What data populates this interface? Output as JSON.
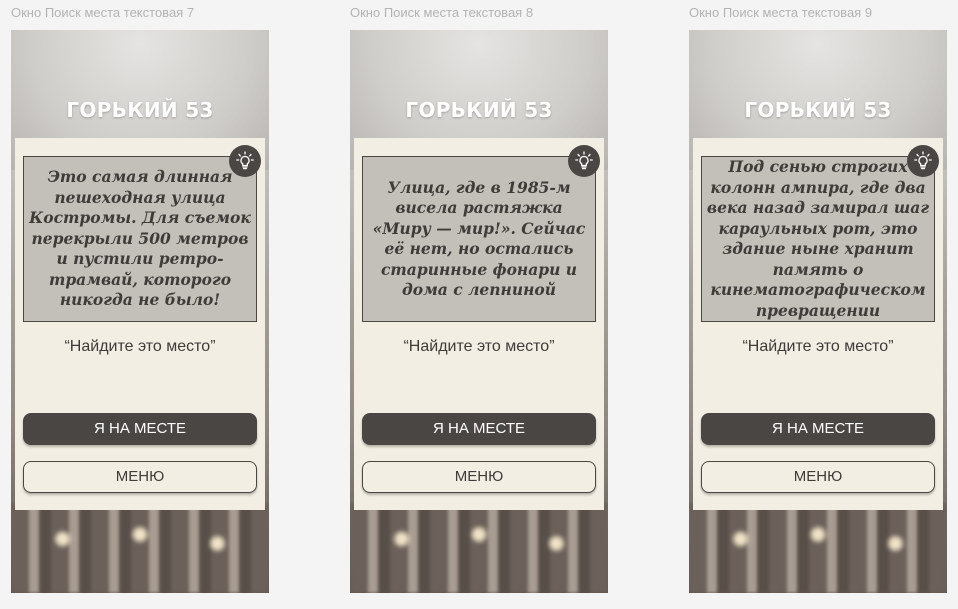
{
  "frames": [
    {
      "label": "Окно Поиск места текстовая 7",
      "title": "ГОРЬКИЙ 53",
      "quote": "Это самая длинная пешеходная улица Костромы. Для съемок перекрыли 500 метров и пустили ретро-трамвай, которого никогда не было!",
      "prompt": "“Найдите это место”",
      "primary_button": "Я НА МЕСТЕ",
      "secondary_button": "МЕНЮ"
    },
    {
      "label": "Окно Поиск места текстовая 8",
      "title": "ГОРЬКИЙ 53",
      "quote": "Улица, где в 1985-м висела растяжка «Миру — мир!». Сейчас её нет, но остались старинные фонари и дома с лепниной",
      "prompt": "“Найдите это место”",
      "primary_button": "Я НА МЕСТЕ",
      "secondary_button": "МЕНЮ"
    },
    {
      "label": "Окно Поиск места текстовая 9",
      "title": "ГОРЬКИЙ 53",
      "quote": "Под сенью строгих колонн ампира, где два века назад замирал шаг караульных рот, это здание ныне хранит память о кинематографическом превращении",
      "prompt": "“Найдите это место”",
      "primary_button": "Я НА МЕСТЕ",
      "secondary_button": "МЕНЮ"
    }
  ],
  "icons": {
    "hint": "lightbulb-icon"
  },
  "colors": {
    "card": "#f2eee3",
    "quote_box": "#c3bfb9",
    "dark": "#4a4644",
    "page_bg": "#f4f4f4"
  }
}
